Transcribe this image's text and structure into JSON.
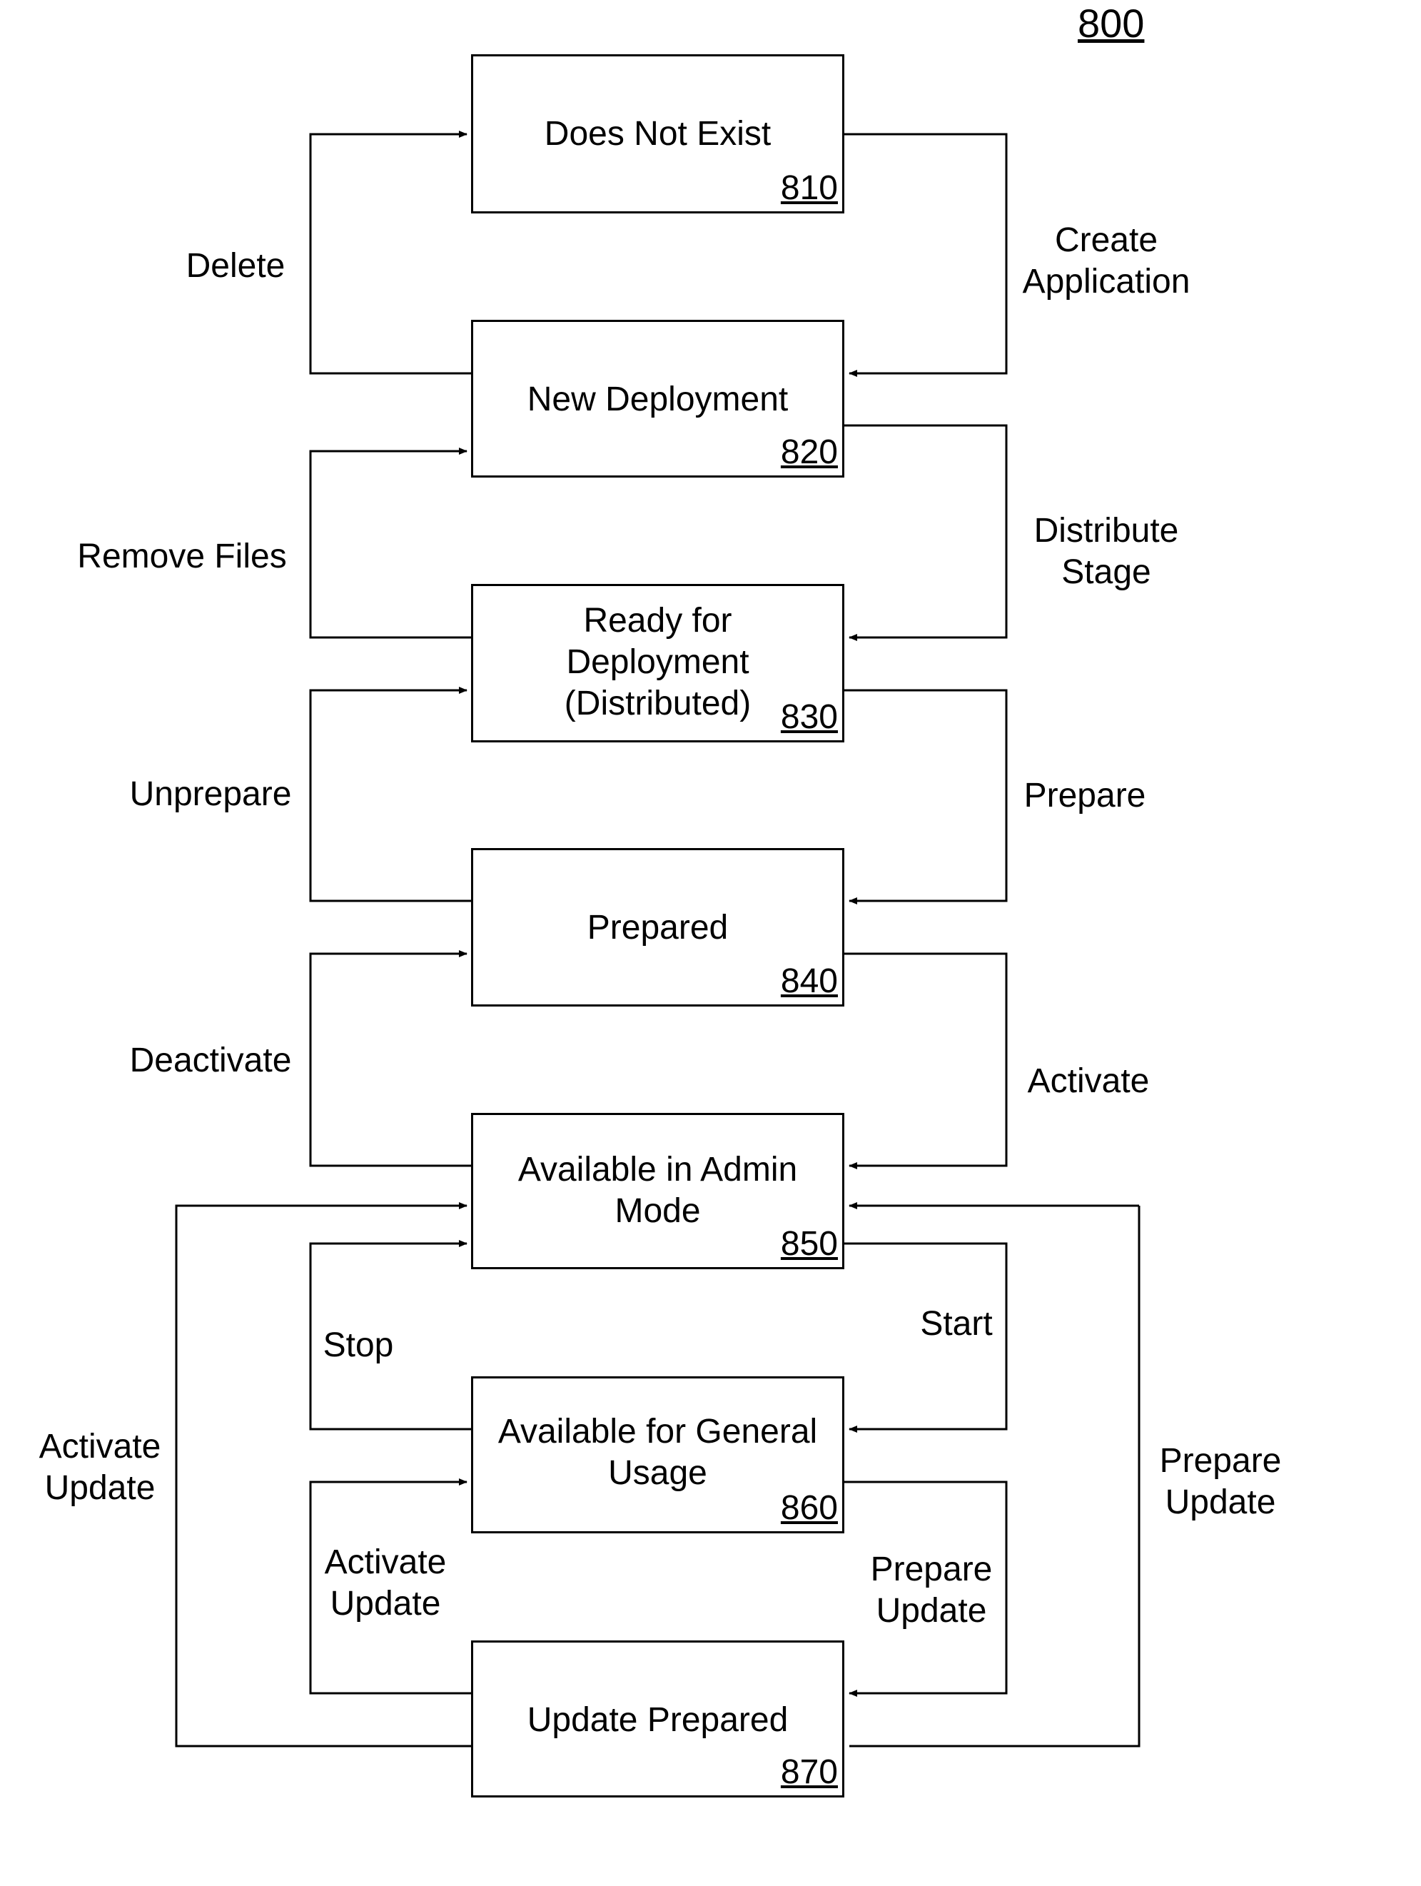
{
  "figure_number": "800",
  "states": [
    {
      "id": "810",
      "label": "Does Not Exist"
    },
    {
      "id": "820",
      "label": "New Deployment"
    },
    {
      "id": "830",
      "label": "Ready for\nDeployment\n(Distributed)"
    },
    {
      "id": "840",
      "label": "Prepared"
    },
    {
      "id": "850",
      "label": "Available in Admin\nMode"
    },
    {
      "id": "860",
      "label": "Available for General\nUsage"
    },
    {
      "id": "870",
      "label": "Update Prepared"
    }
  ],
  "transitions": [
    {
      "from": "810",
      "to": "820",
      "label": "Create\nApplication"
    },
    {
      "from": "820",
      "to": "810",
      "label": "Delete"
    },
    {
      "from": "820",
      "to": "830",
      "label": "Distribute\nStage"
    },
    {
      "from": "830",
      "to": "820",
      "label": "Remove Files"
    },
    {
      "from": "830",
      "to": "840",
      "label": "Prepare"
    },
    {
      "from": "840",
      "to": "830",
      "label": "Unprepare"
    },
    {
      "from": "840",
      "to": "850",
      "label": "Activate"
    },
    {
      "from": "850",
      "to": "840",
      "label": "Deactivate"
    },
    {
      "from": "850",
      "to": "860",
      "label": "Start"
    },
    {
      "from": "860",
      "to": "850",
      "label": "Stop"
    },
    {
      "from": "860",
      "to": "870",
      "label": "Prepare\nUpdate"
    },
    {
      "from": "870",
      "to": "860",
      "label": "Activate\nUpdate"
    },
    {
      "from": "850",
      "to": "870",
      "label": "Prepare\nUpdate"
    },
    {
      "from": "870",
      "to": "850",
      "label": "Activate\nUpdate"
    }
  ]
}
